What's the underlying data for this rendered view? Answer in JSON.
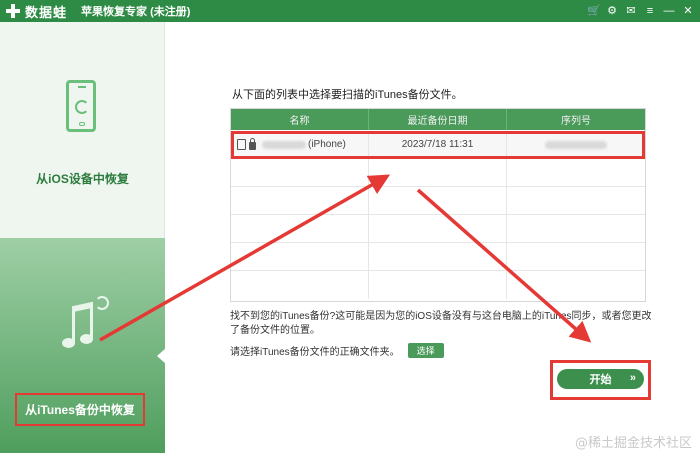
{
  "titlebar": {
    "logo_text": "数据蛙",
    "app_title": "苹果恢复专家 (未注册)",
    "icons": [
      "cart-icon",
      "settings-icon",
      "message-icon",
      "menu-icon",
      "minimize-icon",
      "close-icon"
    ]
  },
  "sidebar": {
    "items": [
      {
        "label": "从iOS设备中恢复",
        "icon": "phone-sync-icon",
        "active": false
      },
      {
        "label": "从iTunes备份中恢复",
        "icon": "music-note-icon",
        "active": true
      }
    ]
  },
  "main": {
    "instruction": "从下面的列表中选择要扫描的iTunes备份文件。",
    "table": {
      "columns": [
        "名称",
        "最近备份日期",
        "序列号"
      ],
      "rows": [
        {
          "name_blurred": true,
          "model": "(iPhone)",
          "date": "2023/7/18 11:31",
          "serial_blurred": true
        }
      ],
      "empty_rows": 5
    },
    "note": "找不到您的iTunes备份?这可能是因为您的iOS设备没有与这台电脑上的iTunes同步，或者您更改了备份文件的位置。",
    "choose_text": "请选择iTunes备份文件的正确文件夹。",
    "choose_button": "选择",
    "start_button": "开始",
    "start_arrows": "»"
  },
  "watermark": "@稀土掘金技术社区",
  "colors": {
    "brand_green": "#2e8b45",
    "header_green": "#4a9a5a",
    "highlight_red": "#e53935"
  }
}
